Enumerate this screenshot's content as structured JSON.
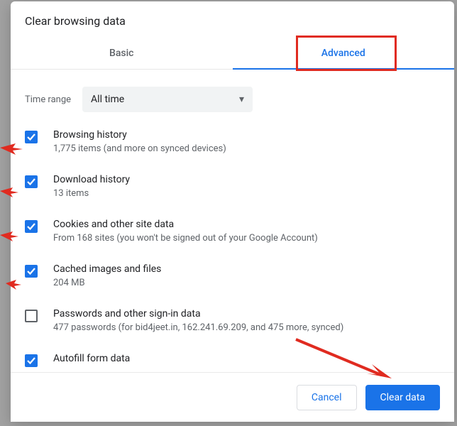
{
  "title": "Clear browsing data",
  "tabs": {
    "basic": "Basic",
    "advanced": "Advanced"
  },
  "time": {
    "label": "Time range",
    "value": "All time"
  },
  "items": [
    {
      "checked": true,
      "title": "Browsing history",
      "sub": "1,775 items (and more on synced devices)"
    },
    {
      "checked": true,
      "title": "Download history",
      "sub": "13 items"
    },
    {
      "checked": true,
      "title": "Cookies and other site data",
      "sub": "From 168 sites (you won't be signed out of your Google Account)"
    },
    {
      "checked": true,
      "title": "Cached images and files",
      "sub": "204 MB"
    },
    {
      "checked": false,
      "title": "Passwords and other sign-in data",
      "sub": "477 passwords (for bid4jeet.in, 162.241.69.209, and 475 more, synced)"
    },
    {
      "checked": true,
      "title": "Autofill form data",
      "sub": ""
    }
  ],
  "buttons": {
    "cancel": "Cancel",
    "clear": "Clear data"
  }
}
